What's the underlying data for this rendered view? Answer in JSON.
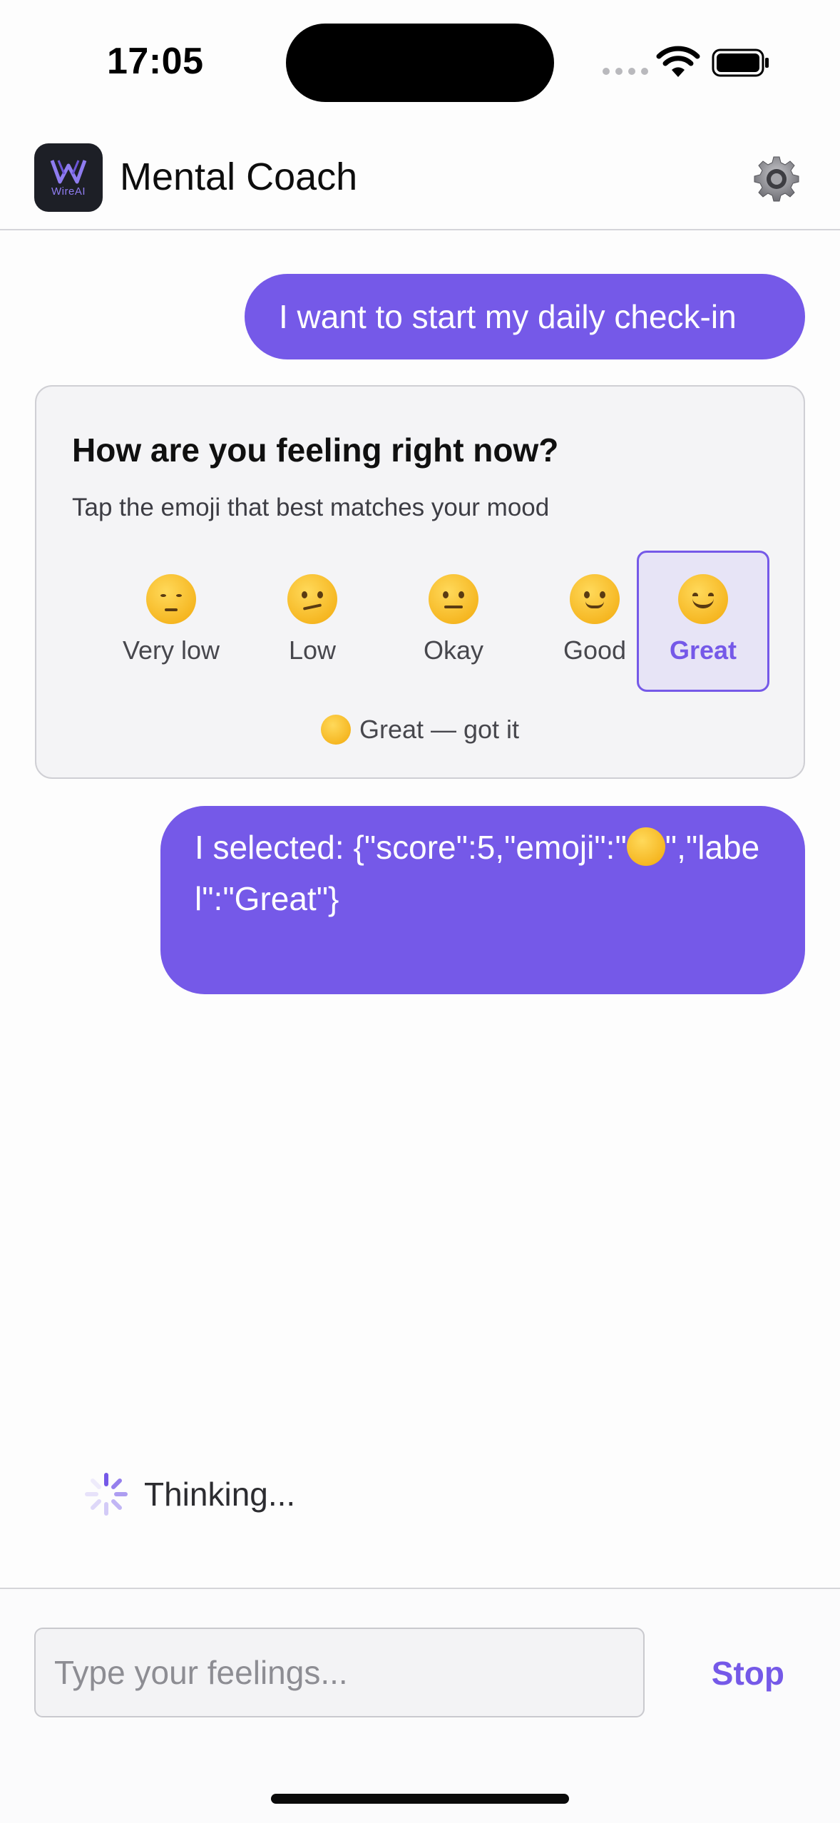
{
  "status_bar": {
    "time": "17:05"
  },
  "header": {
    "logo_text": "WireAI",
    "title": "Mental Coach"
  },
  "messages": {
    "first_user": "I want to start my daily check-in",
    "second_user_prefix": "I selected: {\"score\":5,\"emoji\":\"",
    "second_user_suffix": "\",\"label\":\"Great\"}"
  },
  "mood_card": {
    "title": "How are you feeling right now?",
    "subtitle": "Tap the emoji that best matches your mood",
    "options": [
      {
        "label": "Very low",
        "icon": "pensive-face-icon"
      },
      {
        "label": "Low",
        "icon": "confused-face-icon"
      },
      {
        "label": "Okay",
        "icon": "neutral-face-icon"
      },
      {
        "label": "Good",
        "icon": "slightly-smiling-face-icon"
      },
      {
        "label": "Great",
        "icon": "smiling-face-icon"
      }
    ],
    "selected_index": 4,
    "confirmation": "Great — got it"
  },
  "thinking": {
    "label": "Thinking..."
  },
  "composer": {
    "placeholder": "Type your feelings...",
    "stop_label": "Stop"
  },
  "colors": {
    "accent": "#7559e8",
    "selected_bg": "#e7e4f6",
    "card_bg": "#f4f4f6"
  }
}
